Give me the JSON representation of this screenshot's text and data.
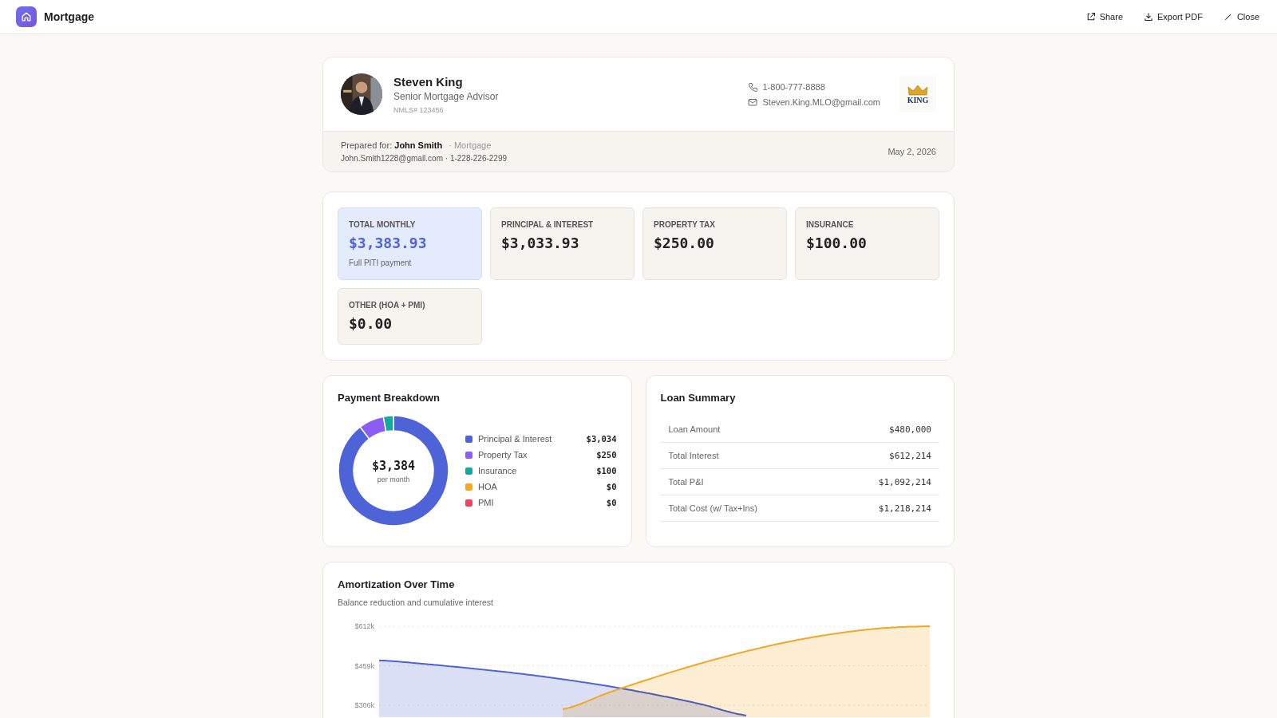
{
  "app_bar": {
    "title": "Mortgage",
    "actions": [
      {
        "kind": "share",
        "label": "Share"
      },
      {
        "kind": "export",
        "label": "Export PDF"
      },
      {
        "kind": "close",
        "label": "Close"
      }
    ]
  },
  "advisor": {
    "name": "Steven King",
    "role": "Senior Mortgage Advisor",
    "nmls": "NMLS# 123456",
    "phone": "1-800-777-8888",
    "email": "Steven.King.MLO@gmail.com",
    "logo_text": "KING"
  },
  "prepared": {
    "label": "Prepared for:",
    "client": "John Smith",
    "tag": "· Mortgage",
    "contact": "John.Smith1228@gmail.com · 1-228-226-2299",
    "date": "May 2, 2026"
  },
  "tiles": [
    {
      "label": "TOTAL MONTHLY",
      "value": "$3,383.93",
      "note": "Full PITI payment",
      "highlighted": true
    },
    {
      "label": "PRINCIPAL & INTEREST",
      "value": "$3,033.93",
      "highlighted": false
    },
    {
      "label": "PROPERTY TAX",
      "value": "$250.00",
      "highlighted": false
    },
    {
      "label": "INSURANCE",
      "value": "$100.00",
      "highlighted": false
    },
    {
      "label": "OTHER (HOA + PMI)",
      "value": "$0.00",
      "highlighted": false
    }
  ],
  "breakdown": {
    "title": "Payment Breakdown",
    "center_value": "$3,384",
    "center_note": "per month",
    "chart_data": {
      "type": "donut",
      "values": [
        89.65,
        7.39,
        2.96,
        0,
        0
      ]
    },
    "legend": [
      {
        "label": "Principal & Interest",
        "amount": "$3,034",
        "color": "#4f63d9"
      },
      {
        "label": "Property Tax",
        "amount": "$250",
        "color": "#8b5cf6"
      },
      {
        "label": "Insurance",
        "amount": "$100",
        "color": "#14a8a0"
      },
      {
        "label": "HOA",
        "amount": "$0",
        "color": "#f5a623"
      },
      {
        "label": "PMI",
        "amount": "$0",
        "color": "#ef4565"
      }
    ]
  },
  "loan_summary": {
    "title": "Loan Summary",
    "rows": [
      {
        "label": "Loan Amount",
        "value": "$480,000"
      },
      {
        "label": "Total Interest",
        "value": "$612,214"
      },
      {
        "label": "Total P&I",
        "value": "$1,092,214"
      },
      {
        "label": "Total Cost (w/ Tax+Ins)",
        "value": "$1,218,214"
      }
    ]
  },
  "amortization": {
    "title": "Amortization Over Time",
    "subtitle": "Balance reduction and cumulative interest",
    "y_axis_labels": [
      "$612k",
      "$459k",
      "$306k"
    ]
  }
}
